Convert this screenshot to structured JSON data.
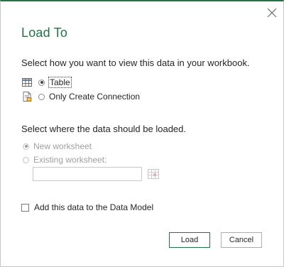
{
  "dialog": {
    "title": "Load To",
    "view_prompt": "Select how you want to view this data in your workbook.",
    "view_options": [
      {
        "label": "Table",
        "icon": "table-icon",
        "checked": true
      },
      {
        "label": "Only Create Connection",
        "icon": "connection-icon",
        "checked": false
      }
    ],
    "location_prompt": "Select where the data should be loaded.",
    "location_options": [
      {
        "label": "New worksheet",
        "checked": true,
        "disabled": true
      },
      {
        "label": "Existing worksheet:",
        "checked": false,
        "disabled": true
      }
    ],
    "existing_worksheet_value": "",
    "data_model_label": "Add this data to the Data Model",
    "data_model_checked": false,
    "load_label": "Load",
    "cancel_label": "Cancel"
  },
  "colors": {
    "accent": "#217346",
    "disabled_text": "#a0a0a0",
    "text": "#262626"
  }
}
